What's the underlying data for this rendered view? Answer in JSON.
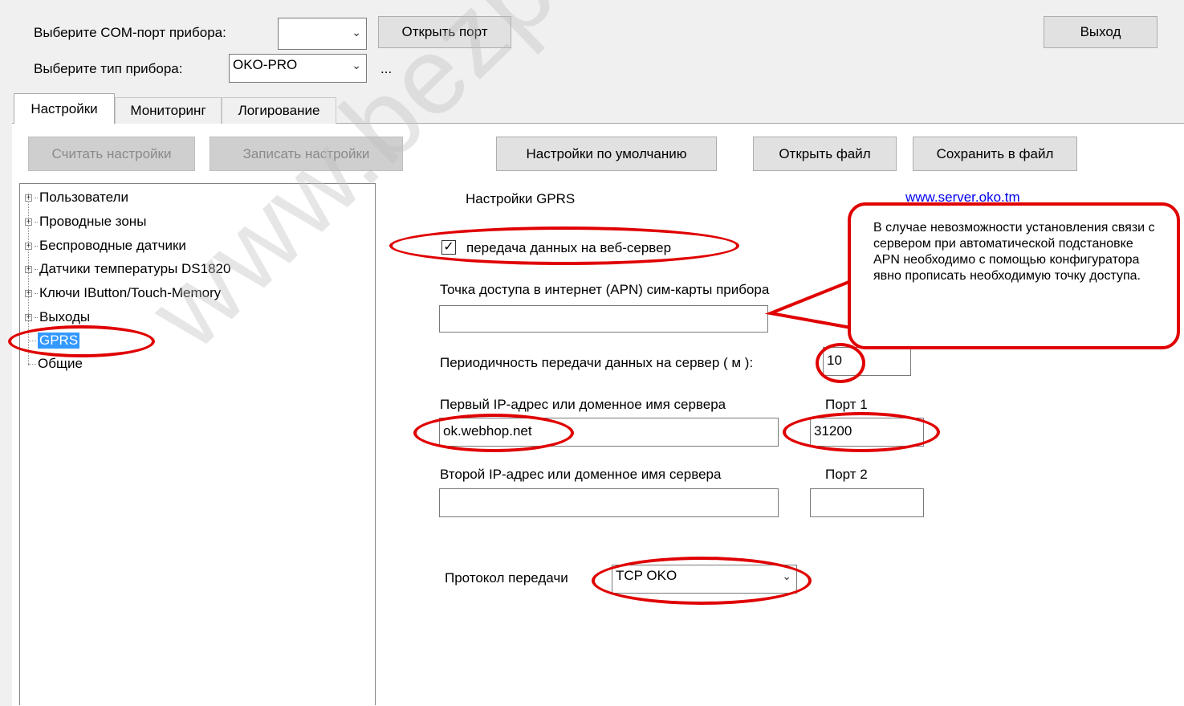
{
  "header": {
    "com_port_label": "Выберите COM-порт прибора:",
    "com_port_value": "",
    "open_port_label": "Открыть порт",
    "exit_label": "Выход",
    "device_type_label": "Выберите тип прибора:",
    "device_type_value": "OKO-PRO",
    "ellipsis": "..."
  },
  "tabs": [
    "Настройки",
    "Мониторинг",
    "Логирование"
  ],
  "toolbar": {
    "read_label": "Считать настройки",
    "write_label": "Записать настройки",
    "defaults_label": "Настройки по умолчанию",
    "open_file_label": "Открыть файл",
    "save_file_label": "Сохранить в файл"
  },
  "tree": [
    "Пользователи",
    "Проводные зоны",
    "Беспроводные датчики",
    "Датчики температуры DS1820",
    "Ключи IButton/Touch-Memory",
    "Выходы",
    "GPRS",
    "Общие"
  ],
  "gprs": {
    "title": "Настройки GPRS",
    "link": "www.server.oko.tm",
    "send_checkbox_label": "передача данных на веб-сервер",
    "send_checked": true,
    "apn_label": "Точка доступа в интернет (APN) сим-карты прибора",
    "apn_value": "",
    "period_label": "Периодичность передачи данных на сервер ( м ):",
    "period_value": "10",
    "ip1_label": "Первый IP-адрес или доменное имя сервера",
    "ip1_value": "ok.webhop.net",
    "port1_label": "Порт 1",
    "port1_value": "31200",
    "ip2_label": "Второй IP-адрес или доменное имя сервера",
    "ip2_value": "",
    "port2_label": "Порт 2",
    "port2_value": "",
    "protocol_label": "Протокол передачи",
    "protocol_value": "TCP OKO"
  },
  "annotation": {
    "text": "В случае невозможности установления связи с сервером при автоматической подстановке APN необходимо с помощью конфигуратора явно прописать необходимую точку доступа."
  },
  "watermark": "www.bezpeka",
  "colors": {
    "highlight": "#e00000",
    "selection": "#3399ff",
    "link": "#0000ee"
  }
}
